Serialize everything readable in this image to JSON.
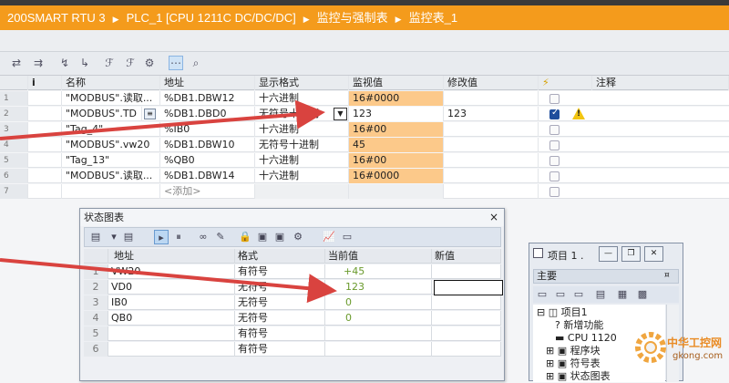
{
  "titlebar": {
    "crumbs": [
      "200SMART RTU 3",
      "PLC_1 [CPU 1211C DC/DC/DC]",
      "监控与强制表",
      "监控表_1"
    ],
    "separator": "▶"
  },
  "colors": {
    "accent": "#f49b1c",
    "monitor_highlight": "#fcc98a",
    "arrow": "#d9433f",
    "ok_green": "#6a9a2c"
  },
  "toolbar": {
    "icons": [
      "monitor-all-icon",
      "monitor-once-icon",
      "modify-icon",
      "modify-once-icon",
      "force-icon",
      "force-stop-icon",
      "show-all-modify-icon",
      "display-format-icon",
      "show-all-icon"
    ]
  },
  "main_table": {
    "headers": {
      "idx": "",
      "info": "i",
      "name": "名称",
      "address": "地址",
      "format": "显示格式",
      "monitor": "监视值",
      "modify": "修改值",
      "flag": "⚡",
      "comment": "注释"
    },
    "rows": [
      {
        "idx": "1",
        "name": "\"MODBUS\".读取...",
        "address": "%DB1.DBW12",
        "format": "十六进制",
        "monitor": "16#0000",
        "modify": "",
        "checked": false,
        "warn": false
      },
      {
        "idx": "2",
        "name": "\"MODBUS\".TD",
        "address": "%DB1.DBD0",
        "format": "无符号十进制",
        "monitor": "123",
        "modify": "123",
        "checked": true,
        "warn": true
      },
      {
        "idx": "3",
        "name": "\"Tag_4\"",
        "address": "%IB0",
        "format": "十六进制",
        "monitor": "16#00",
        "modify": "",
        "checked": false,
        "warn": false
      },
      {
        "idx": "4",
        "name": "\"MODBUS\".vw20",
        "address": "%DB1.DBW10",
        "format": "无符号十进制",
        "monitor": "45",
        "modify": "",
        "checked": false,
        "warn": false
      },
      {
        "idx": "5",
        "name": "\"Tag_13\"",
        "address": "%QB0",
        "format": "十六进制",
        "monitor": "16#00",
        "modify": "",
        "checked": false,
        "warn": false
      },
      {
        "idx": "6",
        "name": "\"MODBUS\".读取...",
        "address": "%DB1.DBW14",
        "format": "十六进制",
        "monitor": "16#0000",
        "modify": "",
        "checked": false,
        "warn": false
      },
      {
        "idx": "7",
        "name": "",
        "address": "<添加>",
        "format": "",
        "monitor": "",
        "modify": "",
        "checked": false,
        "warn": false
      }
    ]
  },
  "status_chart": {
    "title": "状态图表",
    "close": "×",
    "headers": {
      "idx": "",
      "address": "地址",
      "format": "格式",
      "current": "当前值",
      "new": "新值"
    },
    "rows": [
      {
        "idx": "1",
        "address": "VW20",
        "format": "有符号",
        "current": "+45",
        "new": ""
      },
      {
        "idx": "2",
        "address": "VD0",
        "format": "无符号",
        "current": "123",
        "new": ""
      },
      {
        "idx": "3",
        "address": "IB0",
        "format": "无符号",
        "current": "0",
        "new": ""
      },
      {
        "idx": "4",
        "address": "QB0",
        "format": "无符号",
        "current": "0",
        "new": ""
      },
      {
        "idx": "5",
        "address": "",
        "format": "有符号",
        "current": "",
        "new": ""
      },
      {
        "idx": "6",
        "address": "",
        "format": "有符号",
        "current": "",
        "new": ""
      }
    ]
  },
  "project_panel": {
    "title": "项目 1 .",
    "main_label": "主要",
    "pin": "¤",
    "tree": [
      {
        "label": "项目1",
        "icon": "project-icon"
      },
      {
        "label": "新增功能",
        "icon": "new-features-icon"
      },
      {
        "label": "CPU 1120",
        "icon": "cpu-icon"
      },
      {
        "label": "程序块",
        "icon": "program-block-icon"
      },
      {
        "label": "符号表",
        "icon": "symbol-table-icon"
      },
      {
        "label": "状态图表",
        "icon": "status-chart-icon"
      }
    ]
  },
  "watermark": {
    "line1": "中华工控网",
    "line2": "gkong.com"
  }
}
